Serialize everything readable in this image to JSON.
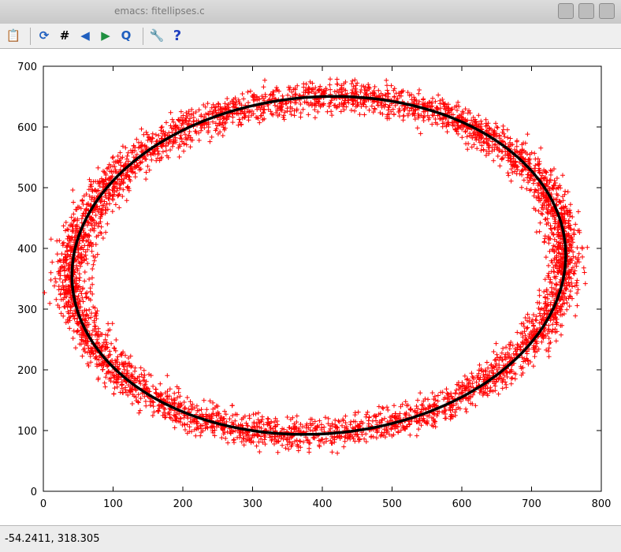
{
  "window": {
    "title": "emacs: fitellipses.c"
  },
  "toolbar": {
    "buttons": [
      {
        "name": "export-button",
        "icon": "clipboard-export-icon",
        "glyph": "📋"
      },
      {
        "name": "replot-button",
        "icon": "refresh-icon",
        "glyph": "⟳"
      },
      {
        "name": "grid-button",
        "icon": "grid-icon",
        "glyph": "#"
      },
      {
        "name": "previous-zoom-button",
        "icon": "zoom-previous-icon",
        "glyph": "◀"
      },
      {
        "name": "next-zoom-button",
        "icon": "zoom-next-icon",
        "glyph": "▶"
      },
      {
        "name": "autoscale-button",
        "icon": "zoom-autoscale-icon",
        "glyph": "Q"
      },
      {
        "name": "config-button",
        "icon": "wrench-icon",
        "glyph": "🔧"
      },
      {
        "name": "help-button",
        "icon": "help-icon",
        "glyph": "?"
      }
    ]
  },
  "status": {
    "coordinates": "-54.2411,  318.305"
  },
  "colors": {
    "points": "#ff0000",
    "fit": "#000000"
  },
  "chart_data": {
    "type": "scatter",
    "title": "",
    "xlabel": "",
    "ylabel": "",
    "xlim": [
      0,
      800
    ],
    "ylim": [
      0,
      700
    ],
    "xticks": [
      "0",
      "100",
      "200",
      "300",
      "400",
      "500",
      "600",
      "700",
      "800"
    ],
    "yticks": [
      "0",
      "100",
      "200",
      "300",
      "400",
      "500",
      "600",
      "700"
    ],
    "grid": false,
    "legend": "none",
    "marker": "+",
    "series": [
      {
        "kind": "points",
        "approx_count": 4500,
        "points_sample": [
          [
            45,
            330
          ],
          [
            50,
            290
          ],
          [
            55,
            250
          ],
          [
            60,
            380
          ],
          [
            70,
            430
          ],
          [
            80,
            200
          ],
          [
            95,
            470
          ],
          [
            110,
            170
          ],
          [
            130,
            510
          ],
          [
            150,
            140
          ],
          [
            180,
            550
          ],
          [
            210,
            120
          ],
          [
            240,
            580
          ],
          [
            270,
            105
          ],
          [
            300,
            610
          ],
          [
            330,
            95
          ],
          [
            360,
            630
          ],
          [
            390,
            100
          ],
          [
            420,
            645
          ],
          [
            450,
            110
          ],
          [
            480,
            650
          ],
          [
            510,
            125
          ],
          [
            540,
            640
          ],
          [
            570,
            150
          ],
          [
            600,
            620
          ],
          [
            630,
            190
          ],
          [
            660,
            580
          ],
          [
            690,
            240
          ],
          [
            710,
            520
          ],
          [
            730,
            300
          ],
          [
            745,
            410
          ],
          [
            740,
            460
          ],
          [
            720,
            350
          ],
          [
            700,
            560
          ],
          [
            650,
            600
          ],
          [
            560,
            130
          ],
          [
            460,
            645
          ],
          [
            350,
            98
          ],
          [
            250,
            110
          ],
          [
            160,
            520
          ]
        ]
      },
      {
        "kind": "fitted-ellipse",
        "center": [
          395,
          372
        ],
        "semi_axes": [
          355,
          277
        ],
        "rotation_deg": 7
      }
    ]
  }
}
